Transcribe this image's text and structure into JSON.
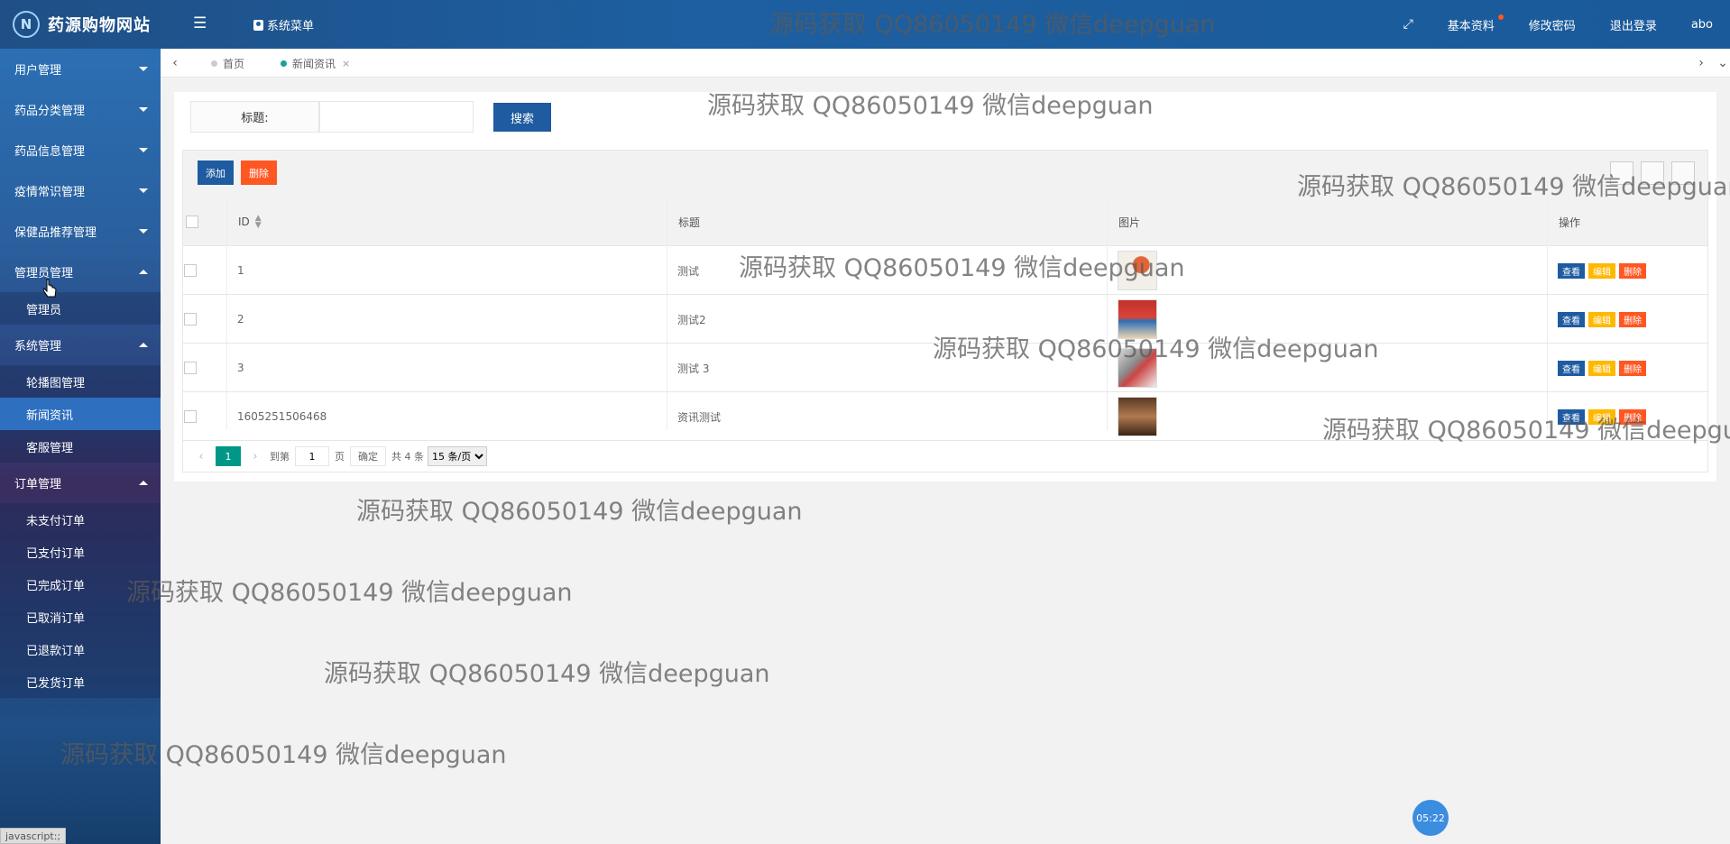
{
  "header": {
    "logo_mark": "N",
    "site_title": "药源购物网站",
    "menu_icon": "list-icon",
    "system_menu_label": "系统菜单",
    "right_items": [
      "基本资料",
      "修改密码",
      "退出登录",
      "abo"
    ],
    "fullscreen_icon": "expand-icon"
  },
  "sidebar": {
    "groups": [
      {
        "label": "用户管理",
        "expanded": false,
        "items": []
      },
      {
        "label": "药品分类管理",
        "expanded": false,
        "items": []
      },
      {
        "label": "药品信息管理",
        "expanded": false,
        "items": []
      },
      {
        "label": "疫情常识管理",
        "expanded": false,
        "items": []
      },
      {
        "label": "保健品推荐管理",
        "expanded": false,
        "items": []
      },
      {
        "label": "管理员管理",
        "expanded": true,
        "items": [
          "管理员"
        ]
      },
      {
        "label": "系统管理",
        "expanded": true,
        "items": [
          "轮播图管理",
          "新闻资讯",
          "客服管理"
        ]
      },
      {
        "label": "订单管理",
        "expanded": true,
        "items": [
          "未支付订单",
          "已支付订单",
          "已完成订单",
          "已取消订单",
          "已退款订单",
          "已发货订单"
        ]
      }
    ],
    "active_item": "新闻资讯"
  },
  "tabs": [
    {
      "label": "首页",
      "active": false
    },
    {
      "label": "新闻资讯",
      "active": true,
      "close": "×"
    }
  ],
  "search": {
    "label": "标题:",
    "value": "",
    "button": "搜索"
  },
  "toolbar": {
    "add_label": "添加",
    "delete_label": "删除",
    "add_color": "#1e5ba0",
    "delete_color": "#ff5722"
  },
  "table": {
    "columns": [
      "ID",
      "标题",
      "图片",
      "操作"
    ],
    "rows": [
      {
        "id": "1",
        "title": "测试"
      },
      {
        "id": "2",
        "title": "测试2"
      },
      {
        "id": "3",
        "title": "测试 3"
      },
      {
        "id": "1605251506468",
        "title": "资讯测试"
      }
    ],
    "actions": [
      "查看",
      "编辑",
      "删除"
    ]
  },
  "pagination": {
    "current": "1",
    "goto_label": "到第",
    "page_value": "1",
    "page_unit": "页",
    "confirm": "确定",
    "total": "共 4 条",
    "page_size": "15 条/页"
  },
  "timer": "05:22",
  "status_bar": "javascript:;",
  "watermark": "源码获取 QQ86050149 微信deepguan"
}
